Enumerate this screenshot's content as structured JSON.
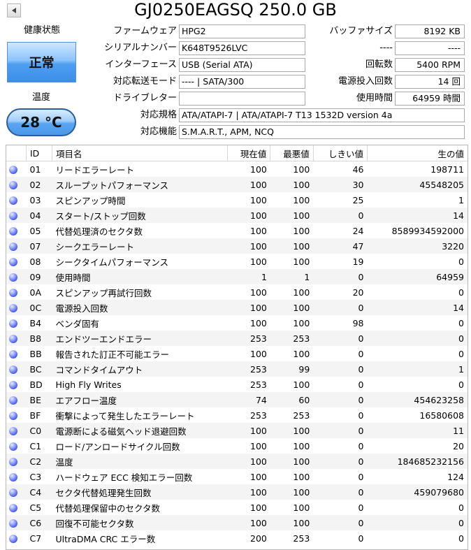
{
  "title": "GJ0250EAGSQ 250.0 GB",
  "left": {
    "health_label": "健康状態",
    "health_value": "正常",
    "temp_label": "温度",
    "temp_value": "28 °C"
  },
  "info": {
    "firmware_label": "ファームウェア",
    "firmware": "HPG2",
    "serial_label": "シリアルナンバー",
    "serial": "K648T9526LVC",
    "interface_label": "インターフェース",
    "interface": "USB (Serial ATA)",
    "transfer_label": "対応転送モード",
    "transfer": "---- | SATA/300",
    "letter_label": "ドライブレター",
    "letter": "",
    "standard_label": "対応規格",
    "standard": "ATA/ATAPI-7 | ATA/ATAPI-7 T13 1532D version 4a",
    "features_label": "対応機能",
    "features": "S.M.A.R.T., APM, NCQ",
    "buffer_label": "バッファサイズ",
    "buffer": "8192 KB",
    "blank_label": "----",
    "blank_value": "----",
    "rpm_label": "回転数",
    "rpm": "5400 RPM",
    "power_count_label": "電源投入回数",
    "power_count": "14 回",
    "hours_label": "使用時間",
    "hours": "64959 時間"
  },
  "table": {
    "headers": [
      "ID",
      "項目名",
      "現在値",
      "最悪値",
      "しきい値",
      "生の値"
    ],
    "rows": [
      {
        "id": "01",
        "name": "リードエラーレート",
        "cur": "100",
        "worst": "100",
        "thr": "46",
        "raw": "198711"
      },
      {
        "id": "02",
        "name": "スループットパフォーマンス",
        "cur": "100",
        "worst": "100",
        "thr": "30",
        "raw": "45548205"
      },
      {
        "id": "03",
        "name": "スピンアップ時間",
        "cur": "100",
        "worst": "100",
        "thr": "25",
        "raw": "1"
      },
      {
        "id": "04",
        "name": "スタート/ストップ回数",
        "cur": "100",
        "worst": "100",
        "thr": "0",
        "raw": "14"
      },
      {
        "id": "05",
        "name": "代替処理済のセクタ数",
        "cur": "100",
        "worst": "100",
        "thr": "24",
        "raw": "8589934592000"
      },
      {
        "id": "07",
        "name": "シークエラーレート",
        "cur": "100",
        "worst": "100",
        "thr": "47",
        "raw": "3220"
      },
      {
        "id": "08",
        "name": "シークタイムパフォーマンス",
        "cur": "100",
        "worst": "100",
        "thr": "19",
        "raw": "0"
      },
      {
        "id": "09",
        "name": "使用時間",
        "cur": "1",
        "worst": "1",
        "thr": "0",
        "raw": "64959"
      },
      {
        "id": "0A",
        "name": "スピンアップ再試行回数",
        "cur": "100",
        "worst": "100",
        "thr": "20",
        "raw": "0"
      },
      {
        "id": "0C",
        "name": "電源投入回数",
        "cur": "100",
        "worst": "100",
        "thr": "0",
        "raw": "14"
      },
      {
        "id": "B4",
        "name": "ベンダ固有",
        "cur": "100",
        "worst": "100",
        "thr": "98",
        "raw": "0"
      },
      {
        "id": "B8",
        "name": "エンドツーエンドエラー",
        "cur": "253",
        "worst": "253",
        "thr": "0",
        "raw": "0"
      },
      {
        "id": "BB",
        "name": "報告された訂正不可能エラー",
        "cur": "100",
        "worst": "100",
        "thr": "0",
        "raw": "0"
      },
      {
        "id": "BC",
        "name": "コマンドタイムアウト",
        "cur": "253",
        "worst": "99",
        "thr": "0",
        "raw": "1"
      },
      {
        "id": "BD",
        "name": "High Fly Writes",
        "cur": "253",
        "worst": "100",
        "thr": "0",
        "raw": "0"
      },
      {
        "id": "BE",
        "name": "エアフロー温度",
        "cur": "74",
        "worst": "60",
        "thr": "0",
        "raw": "454623258"
      },
      {
        "id": "BF",
        "name": "衝撃によって発生したエラーレート",
        "cur": "253",
        "worst": "253",
        "thr": "0",
        "raw": "16580608"
      },
      {
        "id": "C0",
        "name": "電源断による磁気ヘッド退避回数",
        "cur": "100",
        "worst": "100",
        "thr": "0",
        "raw": "11"
      },
      {
        "id": "C1",
        "name": "ロード/アンロードサイクル回数",
        "cur": "100",
        "worst": "100",
        "thr": "0",
        "raw": "20"
      },
      {
        "id": "C2",
        "name": "温度",
        "cur": "100",
        "worst": "100",
        "thr": "0",
        "raw": "184685232156"
      },
      {
        "id": "C3",
        "name": "ハードウェア ECC 検知エラー回数",
        "cur": "100",
        "worst": "100",
        "thr": "0",
        "raw": "124"
      },
      {
        "id": "C4",
        "name": "セクタ代替処理発生回数",
        "cur": "100",
        "worst": "100",
        "thr": "0",
        "raw": "459079680"
      },
      {
        "id": "C5",
        "name": "代替処理保留中のセクタ数",
        "cur": "100",
        "worst": "100",
        "thr": "0",
        "raw": "0"
      },
      {
        "id": "C6",
        "name": "回復不可能セクタ数",
        "cur": "100",
        "worst": "100",
        "thr": "0",
        "raw": "0"
      },
      {
        "id": "C7",
        "name": "UltraDMA CRC エラー数",
        "cur": "200",
        "worst": "253",
        "thr": "0",
        "raw": "0"
      }
    ]
  }
}
